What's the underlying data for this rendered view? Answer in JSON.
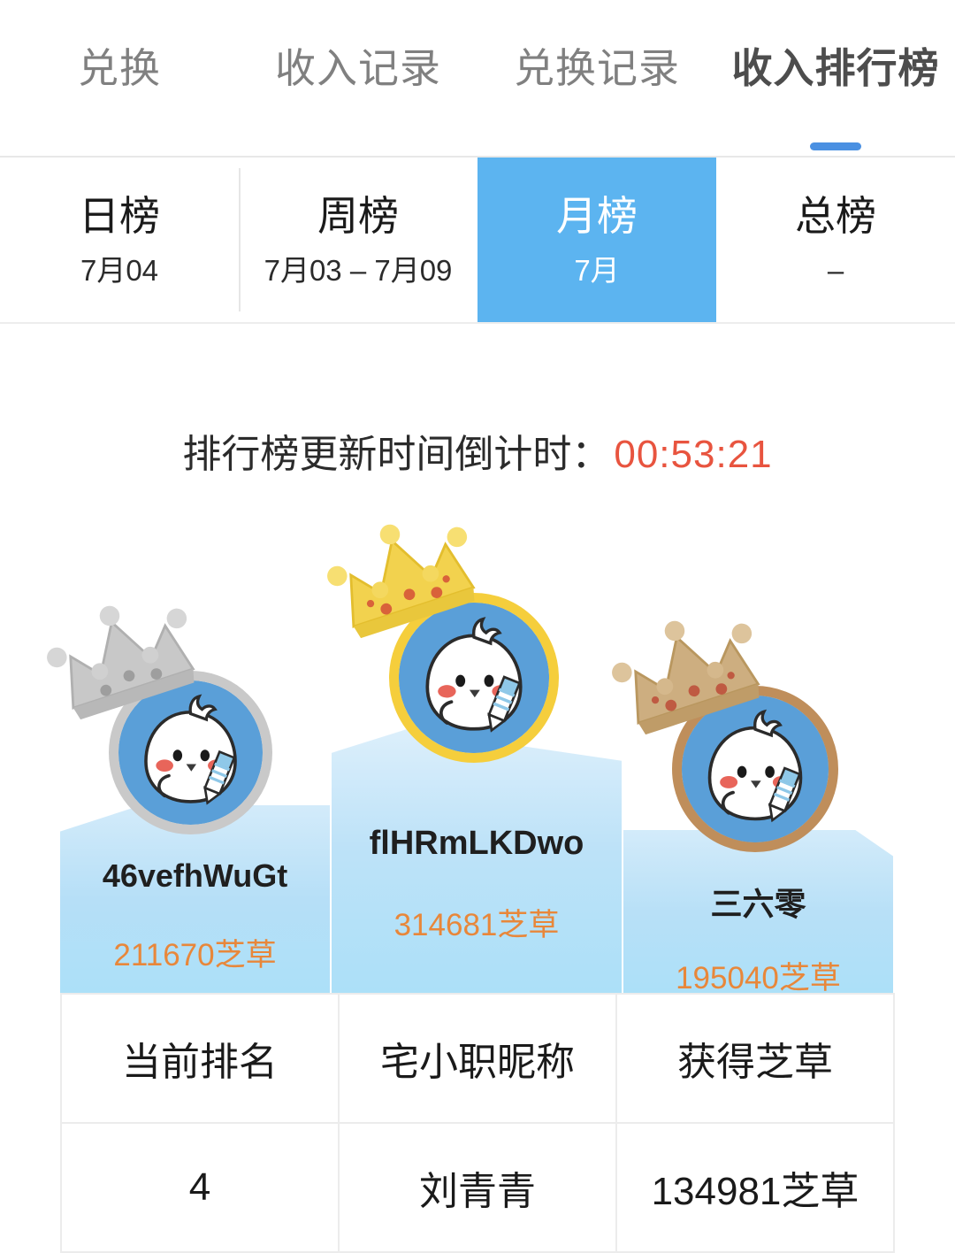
{
  "top_tabs": [
    {
      "label": "兑换",
      "active": false
    },
    {
      "label": "收入记录",
      "active": false
    },
    {
      "label": "兑换记录",
      "active": false
    },
    {
      "label": "收入排行榜",
      "active": true
    }
  ],
  "sub_tabs": [
    {
      "title": "日榜",
      "sub": "7月04",
      "active": false
    },
    {
      "title": "周榜",
      "sub": "7月03 – 7月09",
      "active": false
    },
    {
      "title": "月榜",
      "sub": "7月",
      "active": true
    },
    {
      "title": "总榜",
      "sub": "–",
      "active": false
    }
  ],
  "countdown": {
    "label": "排行榜更新时间倒计时：",
    "value": "00:53:21",
    "color": "#e8543f"
  },
  "podium": [
    {
      "rank": 2,
      "name": "46vefhWuGt",
      "score": "211670芝草",
      "crown": "silver-crown-icon",
      "ring_color": "#c9c9c9"
    },
    {
      "rank": 1,
      "name": "flHRmLKDwo",
      "score": "314681芝草",
      "crown": "gold-crown-icon",
      "ring_color": "#f5ce3c"
    },
    {
      "rank": 3,
      "name": "三六零",
      "score": "195040芝草",
      "crown": "bronze-crown-icon",
      "ring_color": "#bf8e5b"
    }
  ],
  "table": {
    "headers": [
      "当前排名",
      "宅小职昵称",
      "获得芝草"
    ],
    "rows": [
      [
        "4",
        "刘青青",
        "134981芝草"
      ]
    ]
  },
  "colors": {
    "accent_blue": "#4a90e2",
    "active_tab_blue": "#5cb4f0",
    "podium_blue": "#b6dff7",
    "score_orange": "#e8873a",
    "countdown_red": "#e8543f"
  }
}
